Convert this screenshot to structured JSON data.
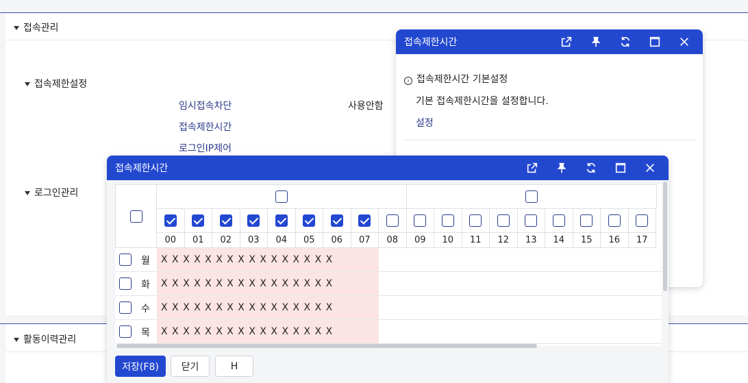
{
  "page": {
    "section_access": "접속관리",
    "section_restrict": "접속제한설정",
    "section_login": "로그인관리",
    "section_activity": "활동이력관리",
    "links": [
      "임시접속차단",
      "접속제한시간",
      "로그인IP제어"
    ],
    "usage_guide": "사용안함"
  },
  "back_window": {
    "title": "접속제한시간",
    "subsection": "접속제한시간 기본설정",
    "description": "기본 접속제한시간을 설정합니다.",
    "setting_link": "설정"
  },
  "front_window": {
    "title": "접속제한시간",
    "hours": [
      "00",
      "01",
      "02",
      "03",
      "04",
      "05",
      "06",
      "07",
      "08",
      "09",
      "10",
      "11",
      "12",
      "13",
      "14",
      "15",
      "16",
      "17"
    ],
    "hours_checked": [
      true,
      true,
      true,
      true,
      true,
      true,
      true,
      true,
      false,
      false,
      false,
      false,
      false,
      false,
      false,
      false,
      false,
      false
    ],
    "rows": [
      {
        "day": "월",
        "marks": "X X X X X X X X X X X X X X X X"
      },
      {
        "day": "화",
        "marks": "X X X X X X X X X X X X X X X X"
      },
      {
        "day": "수",
        "marks": "X X X X X X X X X X X X X X X X"
      },
      {
        "day": "목",
        "marks": "X X X X X X X X X X X X X X X X"
      }
    ],
    "buttons": {
      "save": "저장(F8)",
      "close": "닫기",
      "h": "H"
    }
  },
  "colors": {
    "accent": "#2348d0",
    "blocked": "#fde4e4"
  }
}
